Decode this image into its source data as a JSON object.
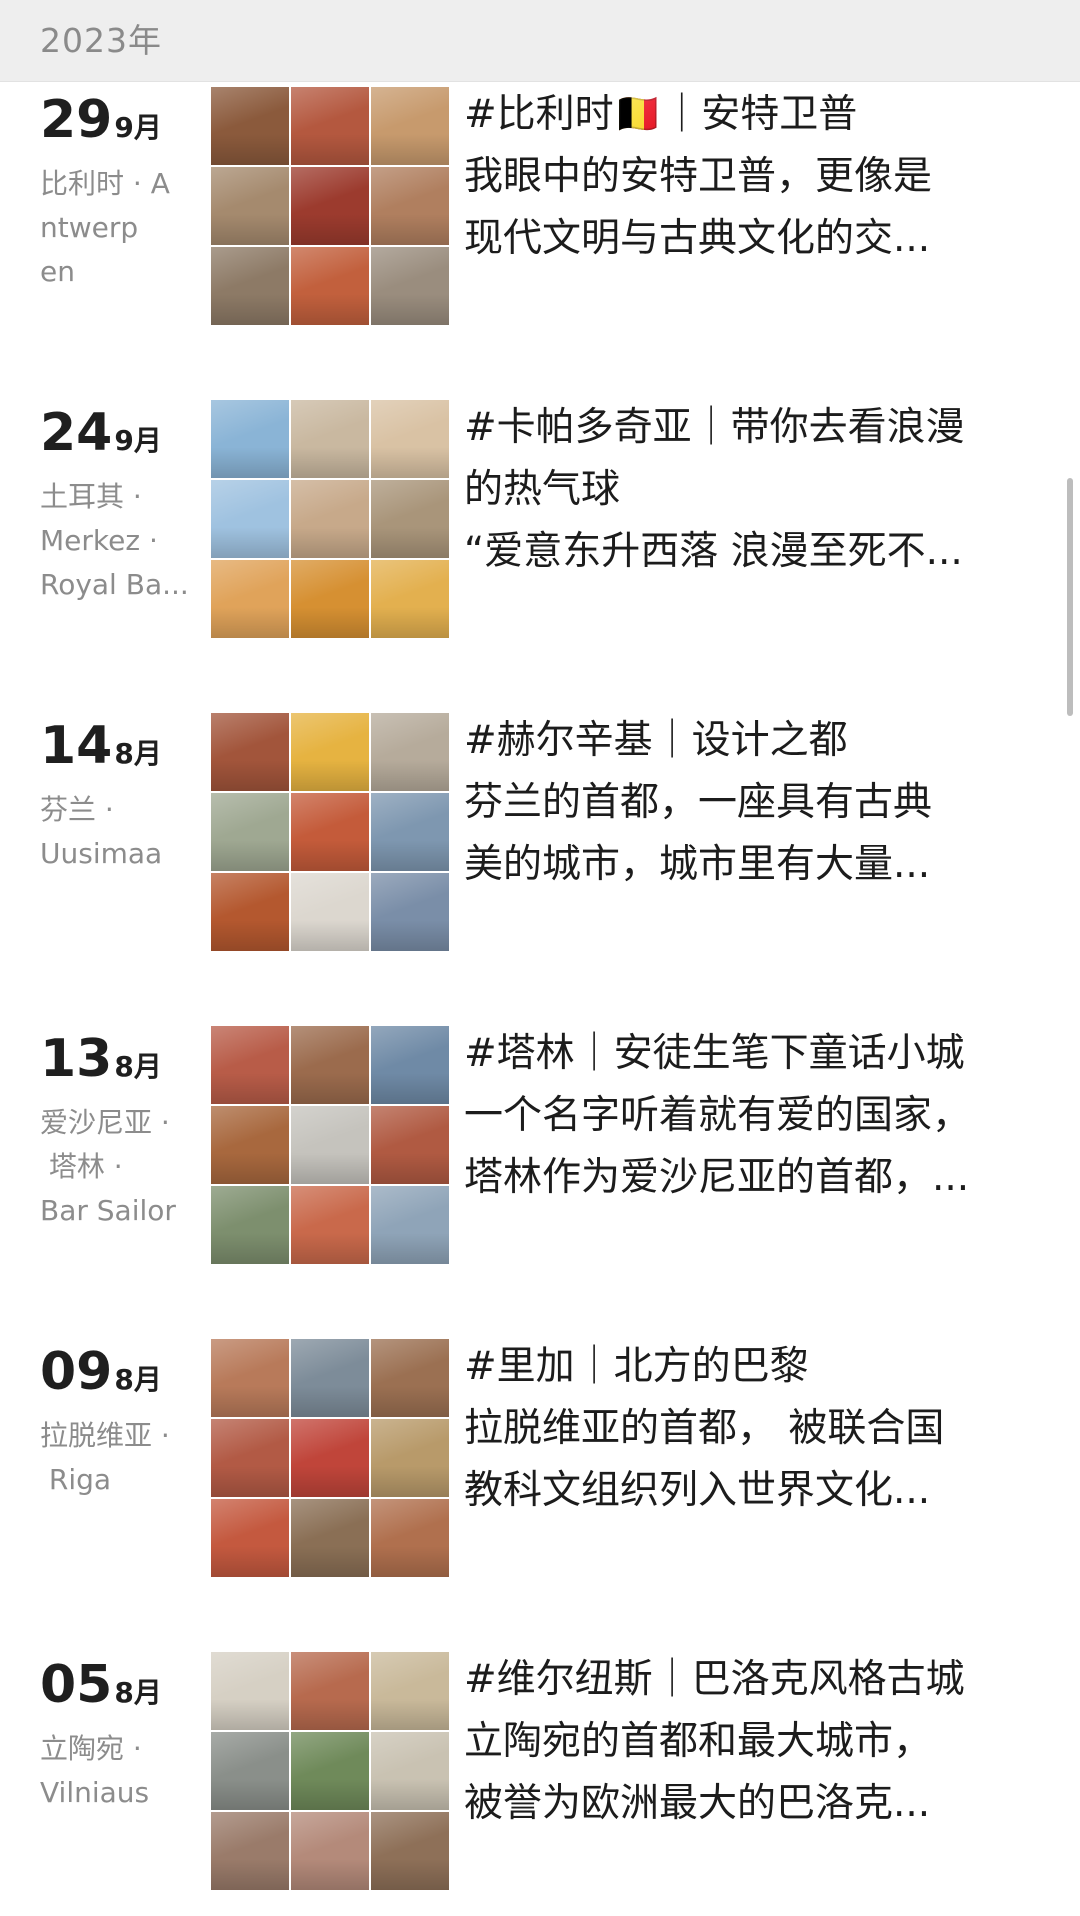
{
  "header": {
    "year": "2023年"
  },
  "posts": [
    {
      "day": "29",
      "month": "9月",
      "location": "比利时 · A\nntwerp\nen",
      "lines": [
        "#比利时🇧🇪｜安特卫普",
        "我眼中的安特卫普，更像是",
        "现代文明与古典文化的交..."
      ],
      "colors": [
        "#8b5a3c",
        "#b4583f",
        "#c79a6d",
        "#a58a6e",
        "#9c3b2e",
        "#b07f5f",
        "#8d7a66",
        "#c2603d",
        "#9a8d7e"
      ]
    },
    {
      "day": "24",
      "month": "9月",
      "location": "土耳其 ·\nMerkez ·\nRoyal Ba...",
      "lines": [
        "#卡帕多奇亚｜带你去看浪漫",
        "的热气球",
        "“爱意东升西落 浪漫至死不..."
      ],
      "colors": [
        "#8ab4d6",
        "#c9b8a0",
        "#d9c2a4",
        "#9fc2e0",
        "#c7a98a",
        "#a9957a",
        "#e0a35a",
        "#d69032",
        "#e3b04f"
      ]
    },
    {
      "day": "14",
      "month": "8月",
      "location": "芬兰 ·\nUusimaa",
      "lines": [
        "#赫尔辛基｜设计之都",
        "芬兰的首都，一座具有古典",
        "美的城市，城市里有大量..."
      ],
      "colors": [
        "#a2553b",
        "#e6b341",
        "#b6ab9b",
        "#9fa892",
        "#c45b3a",
        "#7e97b0",
        "#b4582f",
        "#dcd7cf",
        "#7a8ea8"
      ]
    },
    {
      "day": "13",
      "month": "8月",
      "location": "爱沙尼亚 ·\n 塔林 ·\nBar Sailor",
      "lines": [
        "#塔林｜安徒生笔下童话小城",
        "一个名字听着就有爱的国家，",
        "塔林作为爱沙尼亚的首都，..."
      ],
      "colors": [
        "#b85c48",
        "#9b6b4d",
        "#6f8aa6",
        "#a8683e",
        "#c5c3bd",
        "#b05a42",
        "#7d8f6e",
        "#c9694b",
        "#8fa4b8"
      ]
    },
    {
      "day": "09",
      "month": "8月",
      "location": "拉脱维亚 ·\n Riga",
      "lines": [
        "#里加｜北方的巴黎",
        "拉脱维亚的首都， 被联合国",
        "教科文组织列入世界文化..."
      ],
      "colors": [
        "#b87a5a",
        "#7d8c99",
        "#9b7052",
        "#b25a45",
        "#c0453a",
        "#b89a6a",
        "#c4593f",
        "#8a6f55",
        "#b0704e"
      ]
    },
    {
      "day": "05",
      "month": "8月",
      "location": "立陶宛 ·\nVilniaus",
      "lines": [
        "#维尔纽斯｜巴洛克风格古城",
        "立陶宛的首都和最大城市，",
        "被誉为欧洲最大的巴洛克..."
      ],
      "colors": [
        "#d6d0c4",
        "#b76a4e",
        "#c9b99a",
        "#8a8f8a",
        "#6f8a5a",
        "#c9c2b2",
        "#9a7b6a",
        "#b48a7a",
        "#8e7058"
      ]
    }
  ]
}
